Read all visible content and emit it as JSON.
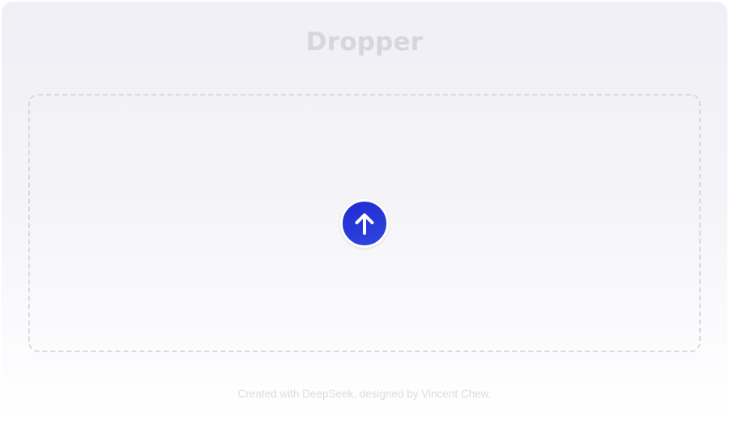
{
  "app": {
    "title": "Dropper"
  },
  "dropzone": {
    "upload_icon": "arrow-up-icon",
    "accent_color": "#2436d8"
  },
  "footer": {
    "credit": "Created with DeepSeek, designed by Vincent Chew."
  }
}
